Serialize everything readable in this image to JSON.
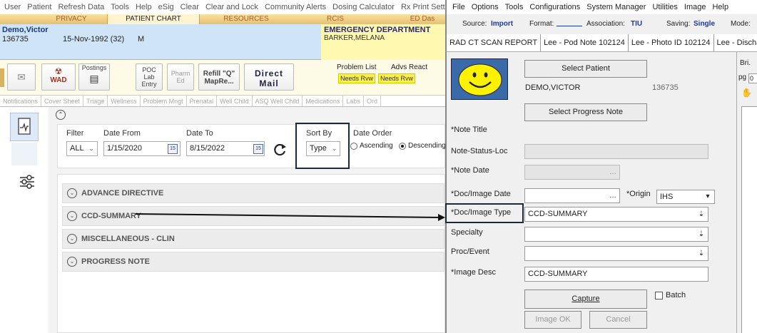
{
  "left": {
    "menu": [
      "User",
      "Patient",
      "Refresh Data",
      "Tools",
      "Help",
      "eSig",
      "Clear",
      "Clear and Lock",
      "Community Alerts",
      "Dosing Calculator",
      "Rx Print Settin"
    ],
    "top_tabs": [
      "PRIVACY",
      "PATIENT CHART",
      "RESOURCES",
      "RCIS",
      "ED Das"
    ],
    "patient": {
      "name": "Demo,Victor",
      "id": "136735",
      "dob": "15-Nov-1992 (32)",
      "sex": "M"
    },
    "department": {
      "name": "EMERGENCY DEPARTMENT",
      "provider": "BARKER,MELANA"
    },
    "toolbar": {
      "wad": "WAD",
      "postings": "Postings",
      "poc": "POC Lab Entry",
      "pharm": "Pharm Ed",
      "refill": "Refill \"Q\" MapRe...",
      "direct": "Direct Mail",
      "problem_list": "Problem List",
      "advs_react": "Advs React",
      "needs_rvw": "Needs Rvw"
    },
    "nav_tabs": [
      "Notifications",
      "Cover Sheet",
      "Triage",
      "Wellness",
      "Problem Mngt",
      "Prenatal",
      "Well Child",
      "ASQ Well Child",
      "Medications",
      "Labs",
      "Ord"
    ],
    "filter": {
      "filter_label": "Filter",
      "filter_value": "ALL",
      "date_from_label": "Date From",
      "date_from": "1/15/2020",
      "date_to_label": "Date To",
      "date_to": "8/15/2022",
      "cal_label": "15",
      "sort_by_label": "Sort By",
      "sort_by_value": "Type",
      "date_order_label": "Date Order",
      "ascending": "Ascending",
      "descending": "Descending"
    },
    "sections": [
      "ADVANCE DIRECTIVE",
      "CCD-SUMMARY",
      "MISCELLANEOUS - CLIN",
      "PROGRESS NOTE"
    ]
  },
  "right": {
    "menu": [
      "File",
      "Options",
      "Tools",
      "Configurations",
      "System Manager",
      "Utilities",
      "Image",
      "Help"
    ],
    "source_label": "Source:",
    "source_value": "Import",
    "format_label": "Format:",
    "association_label": "Association:",
    "association_value": "TIU",
    "saving_label": "Saving:",
    "saving_value": "Single",
    "mode_label": "Mode:",
    "tabs": [
      "RAD CT SCAN REPORT",
      "Lee - Pod Note 102124",
      "Lee - Photo ID 102124",
      "Lee - Discharg"
    ],
    "select_patient": "Select Patient",
    "patient_name": "DEMO,VICTOR",
    "patient_id": "136735",
    "select_progress_note": "Select Progress Note",
    "labels": {
      "note_title": "*Note Title",
      "note_status": "Note-Status-Loc",
      "note_date": "*Note Date",
      "doc_image_date": "*Doc/Image Date",
      "origin": "*Origin",
      "doc_image_type": "*Doc/Image Type",
      "specialty": "Specialty",
      "proc_event": "Proc/Event",
      "image_desc": "*Image Desc"
    },
    "origin_value": "IHS",
    "doc_image_type_value": "CCD-SUMMARY",
    "image_desc_value": "CCD-SUMMARY",
    "capture": "Capture",
    "batch": "Batch",
    "image_ok": "Image OK",
    "cancel": "Cancel",
    "side_bri": "Bri.",
    "side_pg": "pg",
    "side_pg_value": "0"
  }
}
